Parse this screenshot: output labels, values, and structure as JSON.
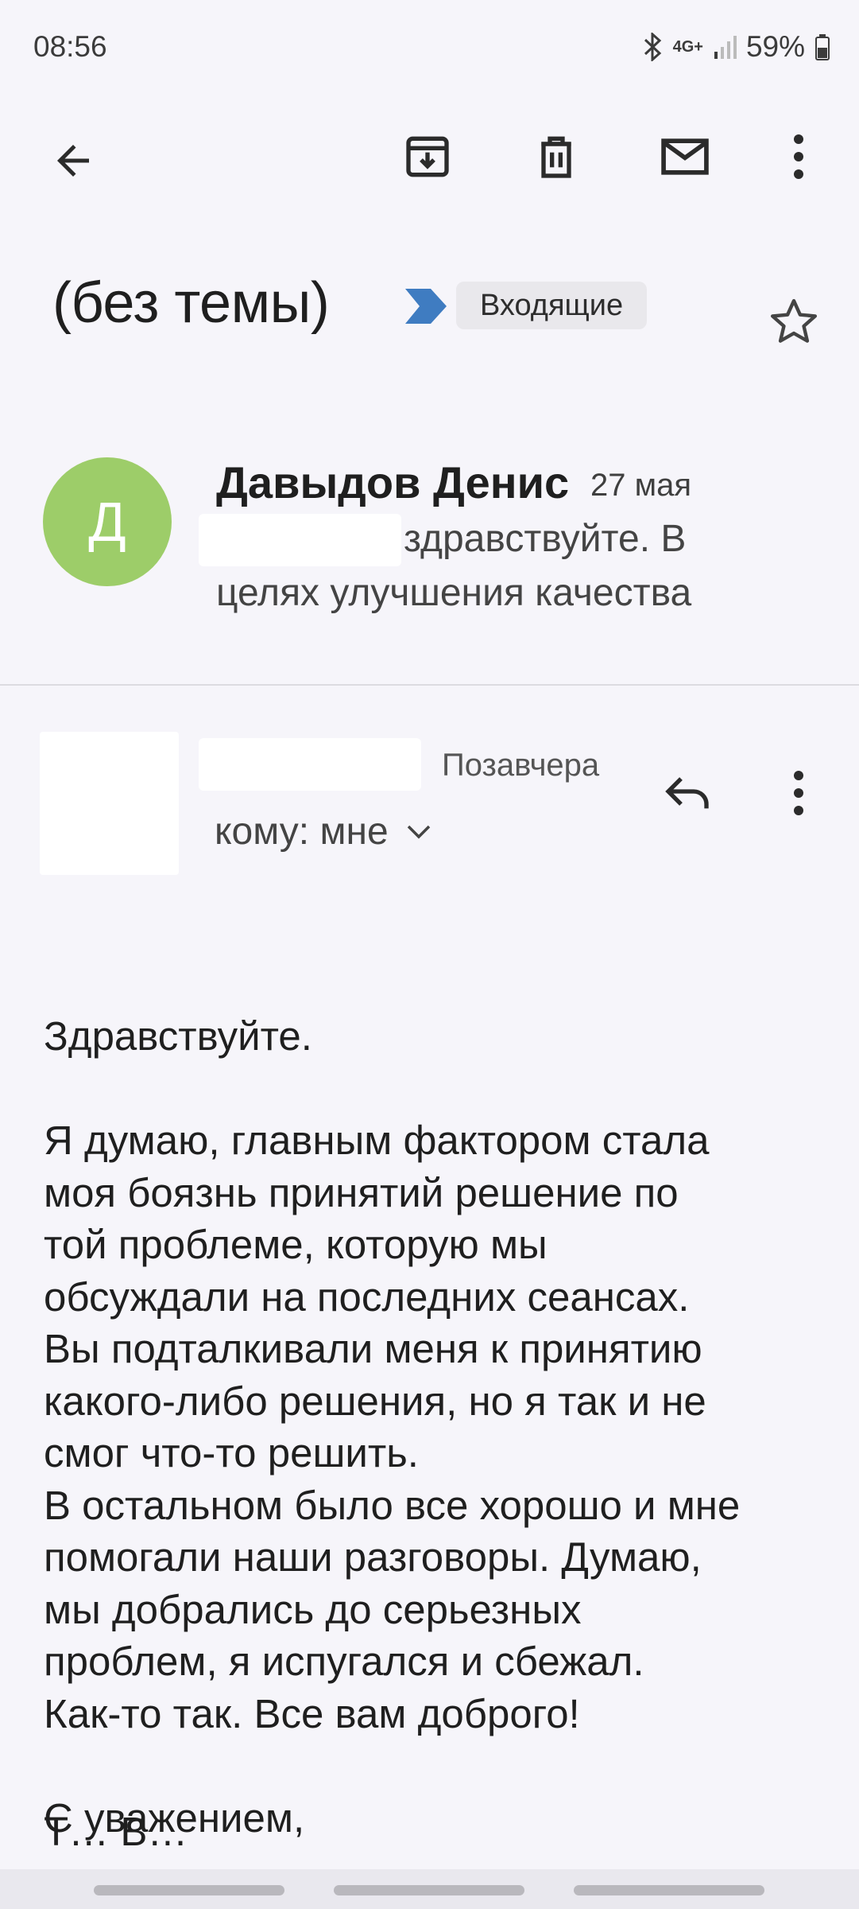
{
  "status_bar": {
    "time": "08:56",
    "network": "4G+",
    "battery": "59%"
  },
  "toolbar": {
    "back_icon": "arrow-left-icon",
    "archive_icon": "archive-icon",
    "delete_icon": "trash-icon",
    "mark_unread_icon": "mail-icon",
    "more_icon": "more-vert-icon"
  },
  "subject": {
    "title": "(без темы)",
    "label": "Входящие",
    "label_color": "#3f7cc1"
  },
  "thread": {
    "avatar_letter": "Д",
    "avatar_color": "#9dcd69",
    "sender": "Давыдов Денис",
    "date": "27 мая",
    "snippet_line1": "здравствуйте. В",
    "snippet_line2": "целях улучшения качества"
  },
  "message": {
    "time": "Позавчера",
    "to": "кому: мне",
    "body": "Здравствуйте.\n\nЯ думаю, главным фактором стала\nмоя боязнь принятий решение по\nтой проблеме, которую мы\nобсуждали на последних сеансах.\nВы подталкивали меня к принятию\nкакого-либо решения, но я так и не\nсмог что-то решить.\nВ остальном было все хорошо и мне\nпомогали наши разговоры. Думаю,\nмы добрались до серьезных\nпроблем, я испугался и сбежал.\nКак-то так. Все вам доброго!\n\nС уважением,",
    "body_cut": "Т… В…"
  }
}
